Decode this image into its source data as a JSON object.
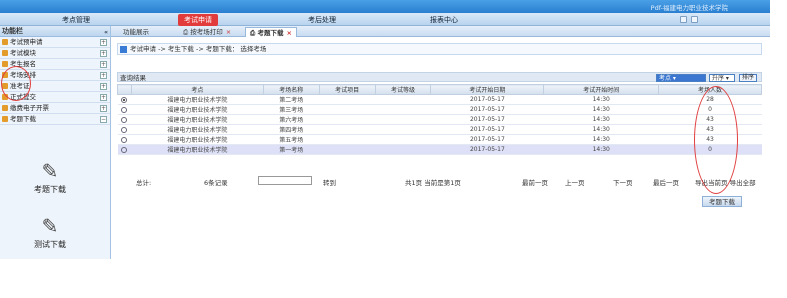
{
  "banner": {
    "brand": "Pdf-福建电力职业技术学院"
  },
  "topnav": {
    "items": [
      "考点管理",
      "考试申请",
      "考后处理",
      "报表中心"
    ]
  },
  "sidebar": {
    "title": "功能栏",
    "items": [
      {
        "label": "考试预申请",
        "expand": "+"
      },
      {
        "label": "考试模块",
        "expand": "+"
      },
      {
        "label": "考生报名",
        "expand": "+"
      },
      {
        "label": "考场安排",
        "expand": "+"
      },
      {
        "label": "准考证",
        "expand": "+"
      },
      {
        "label": "正式提交",
        "expand": "+"
      },
      {
        "label": "缴费电子开票",
        "expand": "+"
      },
      {
        "label": "考题下载",
        "expand": "−"
      }
    ],
    "big_icons": [
      {
        "label": "考题下载",
        "icon": "download-pen-icon"
      },
      {
        "label": "测试下载",
        "icon": "download-pen-icon"
      }
    ]
  },
  "tabs": [
    {
      "label": "功能展示",
      "close": ""
    },
    {
      "label": "按考场打印",
      "close": "×"
    },
    {
      "label": "考题下载",
      "close": "×"
    }
  ],
  "crumb": "考试申请 -> 考生下载 -> 考题下载： 选择考场",
  "results": {
    "title": "查询结果",
    "sort_field": "考点",
    "sort_order": "升序",
    "sort_button": "排序"
  },
  "table": {
    "headers": [
      "",
      "考点",
      "考场名称",
      "考试项目",
      "考试等级",
      "考试开始日期",
      "考试开始时间",
      "考场人数"
    ],
    "rows": [
      {
        "sel": true,
        "site": "福建电力职业技术学院",
        "room": "第二考场",
        "project": "",
        "level": "",
        "date": "2017-05-17",
        "time": "14:30",
        "count": "28"
      },
      {
        "sel": false,
        "site": "福建电力职业技术学院",
        "room": "第三考场",
        "project": "",
        "level": "",
        "date": "2017-05-17",
        "time": "14:30",
        "count": "0"
      },
      {
        "sel": false,
        "site": "福建电力职业技术学院",
        "room": "第六考场",
        "project": "",
        "level": "",
        "date": "2017-05-17",
        "time": "14:30",
        "count": "43"
      },
      {
        "sel": false,
        "site": "福建电力职业技术学院",
        "room": "第四考场",
        "project": "",
        "level": "",
        "date": "2017-05-17",
        "time": "14:30",
        "count": "43"
      },
      {
        "sel": false,
        "site": "福建电力职业技术学院",
        "room": "第五考场",
        "project": "",
        "level": "",
        "date": "2017-05-17",
        "time": "14:30",
        "count": "43"
      },
      {
        "sel": false,
        "site": "福建电力职业技术学院",
        "room": "第一考场",
        "project": "",
        "level": "",
        "date": "2017-05-17",
        "time": "14:30",
        "count": "0"
      }
    ]
  },
  "pager": {
    "total": "总计:",
    "records": "6条记录",
    "goto": "转到",
    "pages": "共1页 当前是第1页",
    "first": "最前一页",
    "prev": "上一页",
    "next": "下一页",
    "last": "最后一页",
    "export": "导出当前页 导出全部"
  },
  "download_button": "考题下载"
}
